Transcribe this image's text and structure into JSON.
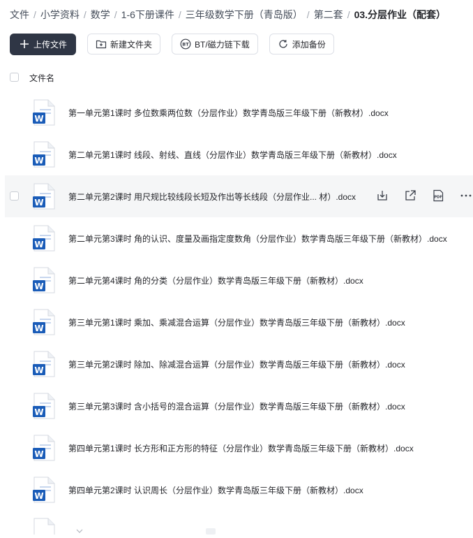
{
  "breadcrumb": [
    "文件",
    "小学资料",
    "数学",
    "1-6下册课件",
    "三年级数学下册（青岛版）",
    "第二套",
    "03.分层作业（配套）"
  ],
  "toolbar": {
    "upload": "上传文件",
    "new_folder": "新建文件夹",
    "bt_download": "BT/磁力链下载",
    "add_backup": "添加备份"
  },
  "table": {
    "column_name": "文件名"
  },
  "files": [
    "第一单元第1课时 多位数乘两位数（分层作业）数学青岛版三年级下册（新教材）.docx",
    "第二单元第1课时 线段、射线、直线（分层作业）数学青岛版三年级下册（新教材）.docx",
    "第二单元第2课时 用尺规比较线段长短及作出等长线段（分层作业... 材）.docx",
    "第二单元第3课时 角的认识、度量及画指定度数角（分层作业）数学青岛版三年级下册（新教材）.docx",
    "第二单元第4课时 角的分类（分层作业）数学青岛版三年级下册（新教材）.docx",
    "第三单元第1课时 乘加、乘减混合运算（分层作业）数学青岛版三年级下册（新教材）.docx",
    "第三单元第2课时 除加、除减混合运算（分层作业）数学青岛版三年级下册（新教材）.docx",
    "第三单元第3课时 含小括号的混合运算（分层作业）数学青岛版三年级下册（新教材）.docx",
    "第四单元第1课时 长方形和正方形的特征（分层作业）数学青岛版三年级下册（新教材）.docx",
    "第四单元第2课时  认识周长（分层作业）数学青岛版三年级下册（新教材）.docx"
  ],
  "hovered_index": 2,
  "icons": {
    "file": "word-doc-icon",
    "actions": [
      "download-icon",
      "share-icon",
      "pdf-icon",
      "more-icon"
    ]
  },
  "colors": {
    "primary_button": "#2f3645",
    "word_blue": "#1a5cb8",
    "hover_row": "#f5f6f7"
  }
}
